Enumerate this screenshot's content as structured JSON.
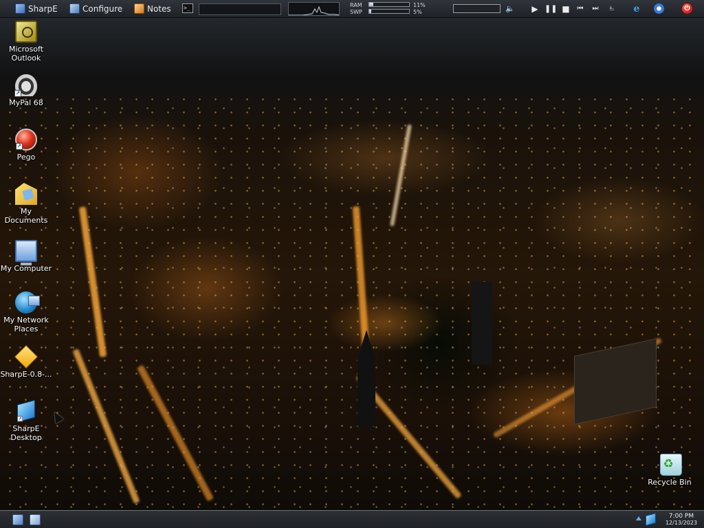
{
  "top_panel": {
    "sharpe_label": "SharpE",
    "configure_label": "Configure",
    "notes_label": "Notes",
    "terminal_glyph": ">_",
    "ram_label": "RAM",
    "ram_value": "11%",
    "ram_fraction": 0.11,
    "swp_label": "SWP",
    "swp_value": "5%",
    "swp_fraction": 0.05,
    "volume_icon": "speaker-icon",
    "media_controls": [
      "play-icon",
      "pause-icon",
      "stop-icon",
      "previous-icon",
      "next-icon"
    ]
  },
  "desktop_icons": [
    {
      "name": "desktop-icon-microsoft-outlook",
      "label": "Microsoft Outlook",
      "icon": "outlook-icon",
      "shortcut": false
    },
    {
      "name": "desktop-icon-mypal-68",
      "label": "MyPal 68",
      "icon": "mypal-icon",
      "shortcut": true
    },
    {
      "name": "desktop-icon-pego",
      "label": "Pego",
      "icon": "pego-icon",
      "shortcut": true
    },
    {
      "name": "desktop-icon-my-documents",
      "label": "My Documents",
      "icon": "documents-folder-icon",
      "shortcut": false
    },
    {
      "name": "desktop-icon-my-computer",
      "label": "My Computer",
      "icon": "computer-icon",
      "shortcut": false
    },
    {
      "name": "desktop-icon-my-network-places",
      "label": "My Network Places",
      "icon": "network-icon",
      "shortcut": false
    },
    {
      "name": "desktop-icon-sharpe-08",
      "label": "SharpE-0.8-...",
      "icon": "sharpe-package-icon",
      "shortcut": false
    },
    {
      "name": "desktop-icon-sharpe-desktop",
      "label": "SharpE Desktop",
      "icon": "sharpe-desktop-icon",
      "shortcut": true
    }
  ],
  "recycle_bin": {
    "label": "Recycle Bin",
    "icon": "recycle-bin-icon"
  },
  "taskbar": {
    "time": "7:00 PM",
    "date": "12/13/2023"
  },
  "colors": {
    "panel_bg": "#2a2d33",
    "panel_text": "#e6e8ec",
    "power_red": "#d12a20",
    "city_light": "#ff9a2e"
  }
}
